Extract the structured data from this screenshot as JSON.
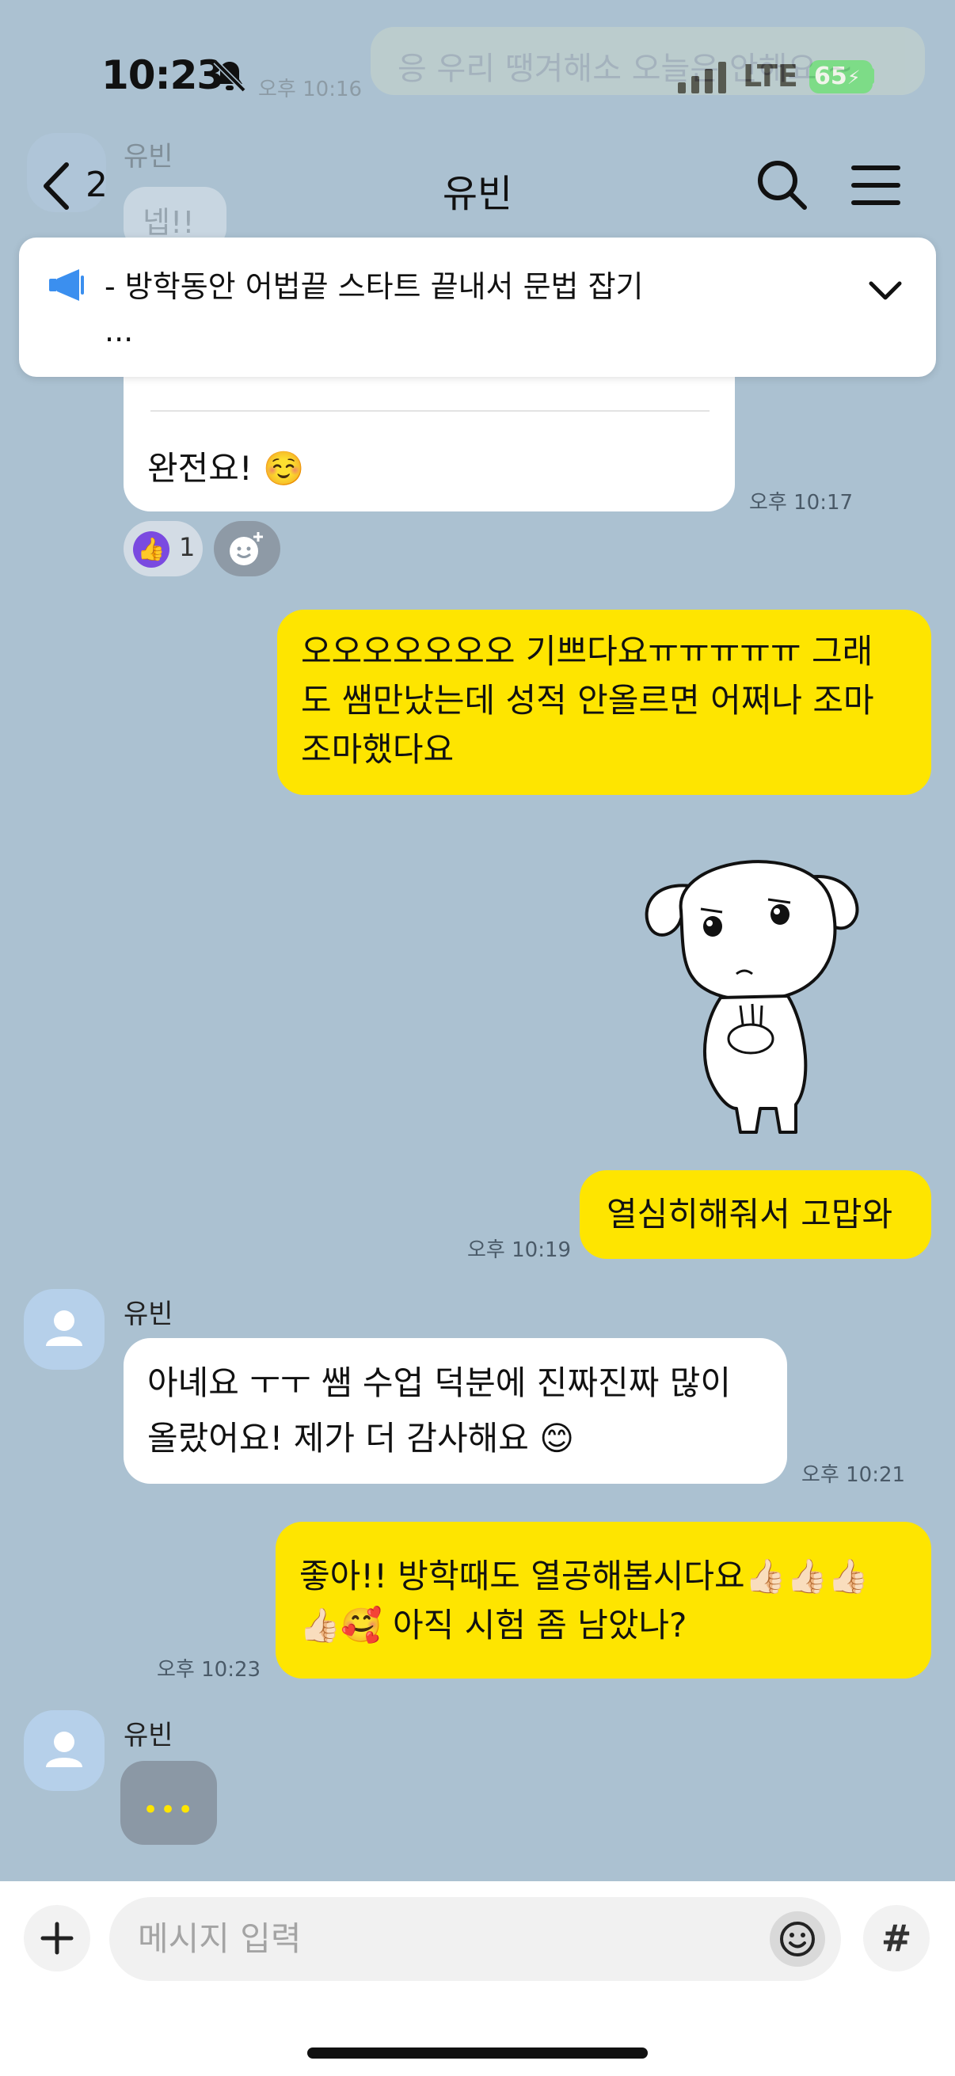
{
  "status_bar": {
    "time": "10:23",
    "network": "LTE",
    "battery": "65"
  },
  "background_messages": {
    "ghost_text": "응 우리 땡겨해소 오늘은 안해요 ~",
    "ghost_time": "오후 10:16",
    "ghost_name": "유빈",
    "ghost_reply": "넵!!"
  },
  "header": {
    "back_count": "2",
    "title": "유빈"
  },
  "notice": {
    "text_line1": "- 방학동안 어법끝 스타트 끝내서 문법 잡기",
    "text_line2": "..."
  },
  "messages": [
    {
      "sender": "유빈",
      "text": "완전요! ☺️",
      "time": "오후 10:17",
      "reactions": {
        "like_count": "1"
      }
    },
    {
      "sender": "me",
      "lines": [
        "오오오오오오오 기쁘다요ㅠㅠㅠㅠㅠ 그래",
        "도 쌤만났는데 성적 안올르면 어쩌나 조마",
        "조마했다요"
      ]
    },
    {
      "sender": "me",
      "type": "sticker"
    },
    {
      "sender": "me",
      "text": "열심히해줘서 고맙와",
      "time": "오후 10:19"
    },
    {
      "sender": "유빈",
      "name": "유빈",
      "lines": [
        "아녜요 ㅜㅜ 쌤 수업 덕분에 진짜진짜 많이",
        "올랐어요! 제가 더 감사해요 😊"
      ],
      "time": "오후 10:21"
    },
    {
      "sender": "me",
      "lines": [
        "좋아!! 방학때도 열공해봅시다요👍🏻👍🏻👍🏻",
        "👍🏻🥰 아직 시험 좀 남았나?"
      ],
      "time": "오후 10:23"
    },
    {
      "sender": "유빈",
      "name": "유빈",
      "type": "typing",
      "dots": "•••"
    }
  ],
  "input": {
    "placeholder": "메시지 입력",
    "hashtag": "#"
  },
  "colors": {
    "background": "#abc1d1",
    "sent_bubble": "#fee500",
    "received_bubble": "#ffffff",
    "battery": "#4cd964"
  }
}
